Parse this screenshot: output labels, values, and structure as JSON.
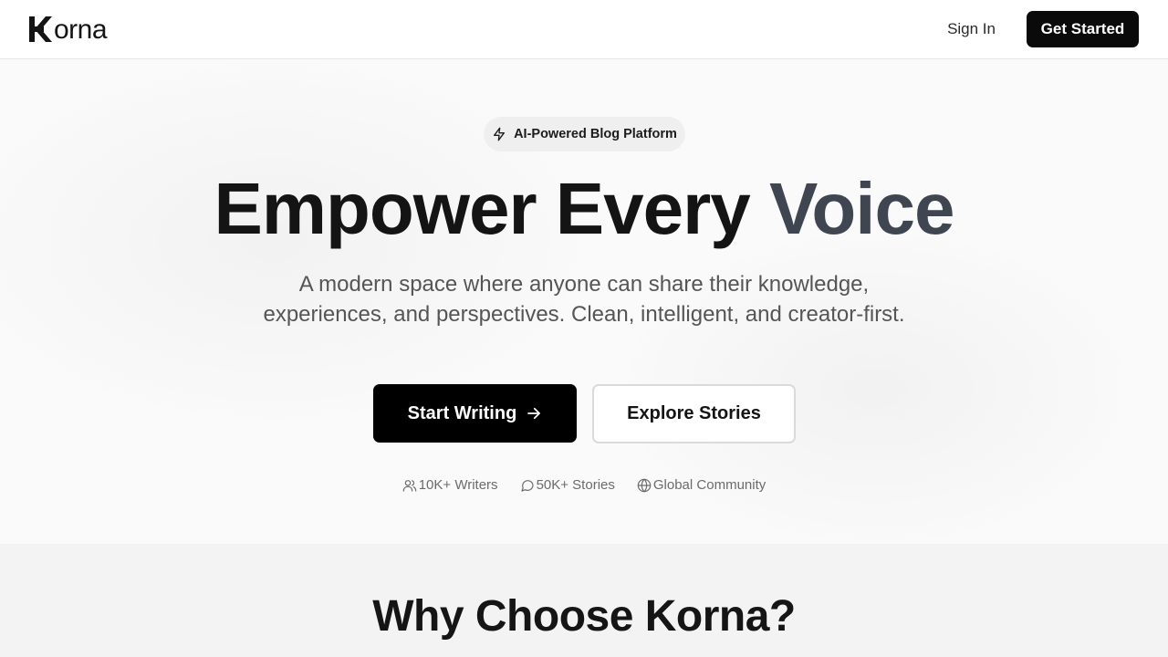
{
  "header": {
    "logo_text": "orna",
    "logo_initial": "K",
    "sign_in_label": "Sign In",
    "get_started_label": "Get Started"
  },
  "hero": {
    "badge_icon": "lightning-icon",
    "badge_label": "AI-Powered Blog Platform",
    "headline_main": "Empower Every ",
    "headline_accent": "Voice",
    "subtitle": "A modern space where anyone can share their knowledge, experiences, and perspectives. Clean, intelligent, and creator-first.",
    "primary_cta_label": "Start Writing",
    "primary_cta_icon": "arrow-right-icon",
    "secondary_cta_label": "Explore Stories",
    "stats": [
      {
        "icon": "users-icon",
        "label": "10K+ Writers"
      },
      {
        "icon": "message-circle-icon",
        "label": "50K+ Stories"
      },
      {
        "icon": "globe-icon",
        "label": "Global Community"
      }
    ]
  },
  "features": {
    "title": "Why Choose Korna?"
  },
  "colors": {
    "accent_text": "#3f4652",
    "primary_button": "#000000",
    "features_background": "#f3f3f3"
  }
}
